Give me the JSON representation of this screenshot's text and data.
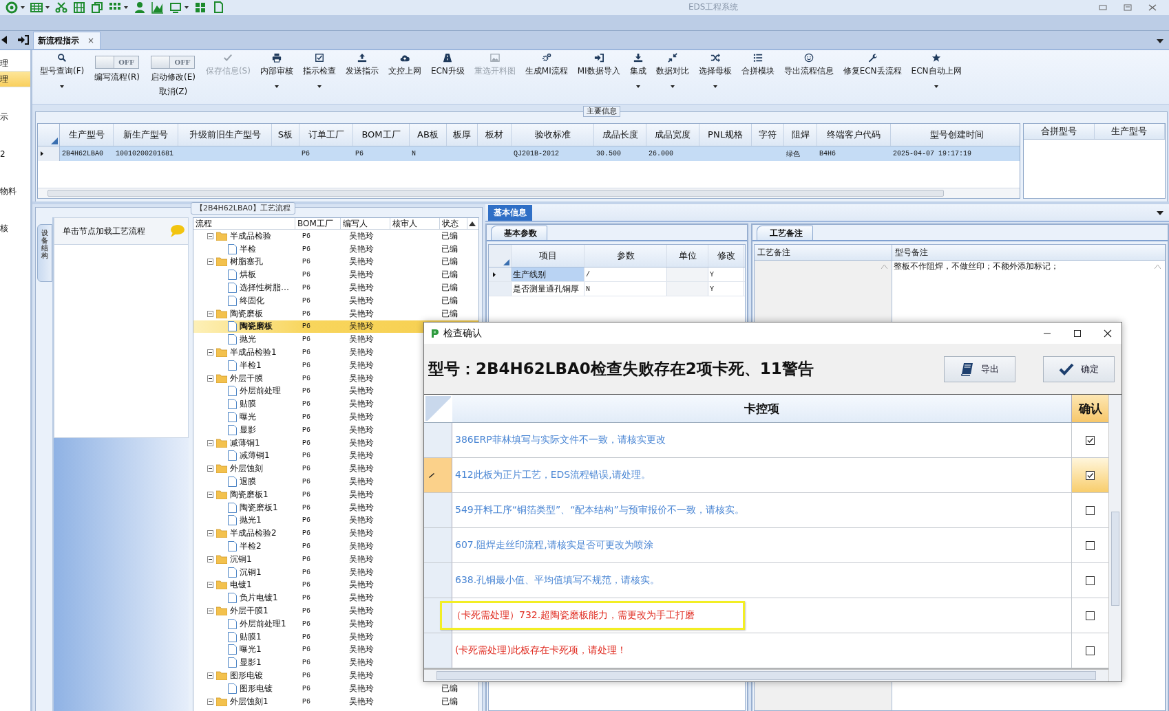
{
  "window": {
    "title": "EDS工程系统"
  },
  "nav_sidebar": {
    "items": [
      {
        "label": "理",
        "selected": false
      },
      {
        "label": "理",
        "selected": true
      },
      {
        "label": "示",
        "selected": false
      },
      {
        "label": "2",
        "selected": false
      },
      {
        "label": "物料",
        "selected": false
      },
      {
        "label": "核",
        "selected": false
      }
    ]
  },
  "document_tab": {
    "label": "新流程指示",
    "close": "×"
  },
  "ribbon": [
    {
      "kind": "button",
      "label": "型号查询(F)",
      "dropdown": true,
      "disabled": false
    },
    {
      "kind": "toggle",
      "label": "编写流程(R)",
      "state_text": "OFF",
      "on": false
    },
    {
      "kind": "toggle",
      "label": "启动修改(E)",
      "sublabel": "取消(Z)",
      "state_text": "OFF",
      "on": false
    },
    {
      "kind": "button",
      "label": "保存信息(S)",
      "dropdown": false,
      "disabled": true
    },
    {
      "kind": "button",
      "label": "内部审核",
      "dropdown": true,
      "disabled": false
    },
    {
      "kind": "button",
      "label": "指示检查",
      "dropdown": true,
      "disabled": false
    },
    {
      "kind": "button",
      "label": "发送指示",
      "dropdown": false,
      "disabled": false
    },
    {
      "kind": "button",
      "label": "文控上网",
      "dropdown": false,
      "disabled": false
    },
    {
      "kind": "button",
      "label": "ECN升级",
      "dropdown": false,
      "disabled": false
    },
    {
      "kind": "button",
      "label": "重选开料图",
      "dropdown": false,
      "disabled": true
    },
    {
      "kind": "button",
      "label": "生成MI流程",
      "dropdown": false,
      "disabled": false
    },
    {
      "kind": "button",
      "label": "MI数据导入",
      "dropdown": false,
      "disabled": false
    },
    {
      "kind": "button",
      "label": "集成",
      "dropdown": true,
      "disabled": false
    },
    {
      "kind": "button",
      "label": "数据对比",
      "dropdown": true,
      "disabled": false
    },
    {
      "kind": "button",
      "label": "选择母板",
      "dropdown": true,
      "disabled": false
    },
    {
      "kind": "button",
      "label": "合拼模块",
      "dropdown": false,
      "disabled": false
    },
    {
      "kind": "button",
      "label": "导出流程信息",
      "dropdown": false,
      "disabled": false
    },
    {
      "kind": "button",
      "label": "修复ECN丢流程",
      "dropdown": false,
      "disabled": false
    },
    {
      "kind": "button",
      "label": "ECN自动上网",
      "dropdown": true,
      "disabled": false
    }
  ],
  "main_info": {
    "title": "主要信息",
    "columns": [
      "生产型号",
      "新生产型号",
      "升级前旧生产型号",
      "S板",
      "订单工厂",
      "BOM工厂",
      "AB板",
      "板厚",
      "板材",
      "验收标准",
      "成品长度",
      "成品宽度",
      "PNL规格",
      "字符",
      "阻焊",
      "终端客户代码",
      "型号创建时间"
    ],
    "rows": [
      {
        "selected": true,
        "cells": [
          "2B4H62LBA0",
          "10010200201681",
          null,
          null,
          "P6",
          "P6",
          "N",
          null,
          null,
          "QJ201B-2012",
          "30.500",
          "26.000",
          null,
          null,
          "绿色",
          "B4H6",
          "2025-04-07 19:17:19"
        ]
      }
    ],
    "side_columns": [
      "合拼型号",
      "生产型号"
    ]
  },
  "process_panel": {
    "title": "【2B4H62LBA0】工艺流程",
    "side_tab": "设备结构",
    "hint": "单击节点加载工艺流程",
    "columns": [
      "流程",
      "BOM工厂",
      "编写人",
      "核审人",
      "状态"
    ],
    "tree": [
      {
        "name": "半成品检验",
        "bom": "P6",
        "writer": "吴艳玲",
        "status": "已编",
        "expanded": true,
        "selected": false,
        "children": [
          {
            "name": "半检",
            "bom": "P6",
            "writer": "吴艳玲",
            "status": "已编",
            "selected": false
          }
        ]
      },
      {
        "name": "树脂塞孔",
        "bom": "P6",
        "writer": "吴艳玲",
        "status": "已编",
        "expanded": true,
        "selected": false,
        "children": [
          {
            "name": "烘板",
            "bom": "P6",
            "writer": "吴艳玲",
            "status": "已编",
            "selected": false
          },
          {
            "name": "选择性树脂…",
            "bom": "P6",
            "writer": "吴艳玲",
            "status": "已编",
            "selected": false
          },
          {
            "name": "终固化",
            "bom": "P6",
            "writer": "吴艳玲",
            "status": "已编",
            "selected": false
          }
        ]
      },
      {
        "name": "陶瓷磨板",
        "bom": "P6",
        "writer": "吴艳玲",
        "status": "已编",
        "expanded": true,
        "selected": false,
        "children": [
          {
            "name": "陶瓷磨板",
            "bom": "P6",
            "writer": "吴艳玲",
            "selected": true
          },
          {
            "name": "抛光",
            "bom": "P6",
            "writer": "吴艳玲",
            "selected": false
          }
        ]
      },
      {
        "name": "半成品检验1",
        "bom": "P6",
        "writer": "吴艳玲",
        "expanded": true,
        "selected": false,
        "children": [
          {
            "name": "半检1",
            "bom": "P6",
            "writer": "吴艳玲",
            "selected": false
          }
        ]
      },
      {
        "name": "外层干膜",
        "bom": "P6",
        "writer": "吴艳玲",
        "expanded": true,
        "selected": false,
        "children": [
          {
            "name": "外层前处理",
            "bom": "P6",
            "writer": "吴艳玲",
            "selected": false
          },
          {
            "name": "贴膜",
            "bom": "P6",
            "writer": "吴艳玲",
            "selected": false
          },
          {
            "name": "曝光",
            "bom": "P6",
            "writer": "吴艳玲",
            "selected": false
          },
          {
            "name": "显影",
            "bom": "P6",
            "writer": "吴艳玲",
            "selected": false
          }
        ]
      },
      {
        "name": "减薄铜1",
        "bom": "P6",
        "writer": "吴艳玲",
        "expanded": true,
        "selected": false,
        "children": [
          {
            "name": "减薄铜1",
            "bom": "P6",
            "writer": "吴艳玲",
            "selected": false
          }
        ]
      },
      {
        "name": "外层蚀刻",
        "bom": "P6",
        "writer": "吴艳玲",
        "expanded": true,
        "selected": false,
        "children": [
          {
            "name": "退膜",
            "bom": "P6",
            "writer": "吴艳玲",
            "selected": false
          }
        ]
      },
      {
        "name": "陶瓷磨板1",
        "bom": "P6",
        "writer": "吴艳玲",
        "expanded": true,
        "selected": false,
        "children": [
          {
            "name": "陶瓷磨板1",
            "bom": "P6",
            "writer": "吴艳玲",
            "selected": false
          },
          {
            "name": "抛光1",
            "bom": "P6",
            "writer": "吴艳玲",
            "selected": false
          }
        ]
      },
      {
        "name": "半成品检验2",
        "bom": "P6",
        "writer": "吴艳玲",
        "expanded": true,
        "selected": false,
        "children": [
          {
            "name": "半检2",
            "bom": "P6",
            "writer": "吴艳玲",
            "selected": false
          }
        ]
      },
      {
        "name": "沉铜1",
        "bom": "P6",
        "writer": "吴艳玲",
        "expanded": true,
        "selected": false,
        "children": [
          {
            "name": "沉铜1",
            "bom": "P6",
            "writer": "吴艳玲",
            "selected": false
          }
        ]
      },
      {
        "name": "电镀1",
        "bom": "P6",
        "writer": "吴艳玲",
        "expanded": true,
        "selected": false,
        "children": [
          {
            "name": "负片电镀1",
            "bom": "P6",
            "writer": "吴艳玲",
            "selected": false
          }
        ]
      },
      {
        "name": "外层干膜1",
        "bom": "P6",
        "writer": "吴艳玲",
        "expanded": true,
        "selected": false,
        "children": [
          {
            "name": "外层前处理1",
            "bom": "P6",
            "writer": "吴艳玲",
            "selected": false
          },
          {
            "name": "贴膜1",
            "bom": "P6",
            "writer": "吴艳玲",
            "selected": false
          },
          {
            "name": "曝光1",
            "bom": "P6",
            "writer": "吴艳玲",
            "selected": false
          },
          {
            "name": "显影1",
            "bom": "P6",
            "writer": "吴艳玲",
            "selected": false
          }
        ]
      },
      {
        "name": "图形电镀",
        "bom": "P6",
        "writer": "吴艳玲",
        "expanded": true,
        "selected": false,
        "children": [
          {
            "name": "图形电镀",
            "bom": "P6",
            "writer": "吴艳玲",
            "status": "已编",
            "selected": false
          }
        ]
      },
      {
        "name": "外层蚀刻1",
        "bom": "P6",
        "writer": "吴艳玲",
        "status": "已编",
        "expanded": true,
        "selected": false
      }
    ]
  },
  "basic_info": {
    "tab": "基本信息",
    "params_tab": "基本参数",
    "param_columns": [
      "项目",
      "参数",
      "单位",
      "修改"
    ],
    "param_rows": [
      {
        "item": "生产线别",
        "value": "/",
        "modify": "Y",
        "selected": true
      },
      {
        "item": "是否测量通孔铜厚",
        "value": "N",
        "modify": "Y",
        "selected": false
      }
    ],
    "notes_tab": "工艺备注",
    "notes_columns": [
      "工艺备注",
      "型号备注"
    ],
    "model_note": "整板不作阻焊，不做丝印；不额外添加标记；"
  },
  "dialog": {
    "title": "检查确认",
    "heading": "型号：2B4H62LBA0检查失败存在2项卡死、11警告",
    "buttons": [
      "导出",
      "确定"
    ],
    "columns": [
      "卡控项",
      "确认"
    ],
    "rows": [
      {
        "kind": "warning",
        "text": "386ERP菲林填写与实际文件不一致，请核实更改",
        "checked": true,
        "selected": false,
        "highlighted": false
      },
      {
        "kind": "warning",
        "text": "412此板为正片工艺，EDS流程错误,请处理。",
        "checked": true,
        "selected": true,
        "highlighted": false
      },
      {
        "kind": "warning",
        "text": "549开料工序“铜箔类型”、“配本结构”与预审报价不一致，请核实。",
        "checked": false,
        "selected": false,
        "highlighted": false
      },
      {
        "kind": "warning",
        "text": "607.阻焊走丝印流程,请核实是否可更改为喷涂",
        "checked": false,
        "selected": false,
        "highlighted": false
      },
      {
        "kind": "warning",
        "text": "638.孔铜最小值、平均值填写不规范，请核实。",
        "checked": false,
        "selected": false,
        "highlighted": false
      },
      {
        "kind": "blocking",
        "text": "（卡死需处理）732.超陶瓷磨板能力，需更改为手工打磨",
        "checked": false,
        "selected": false,
        "highlighted": true
      },
      {
        "kind": "blocking",
        "text": "(卡死需处理)此板存在卡死项，请处理！",
        "checked": false,
        "selected": false,
        "highlighted": false
      }
    ]
  }
}
